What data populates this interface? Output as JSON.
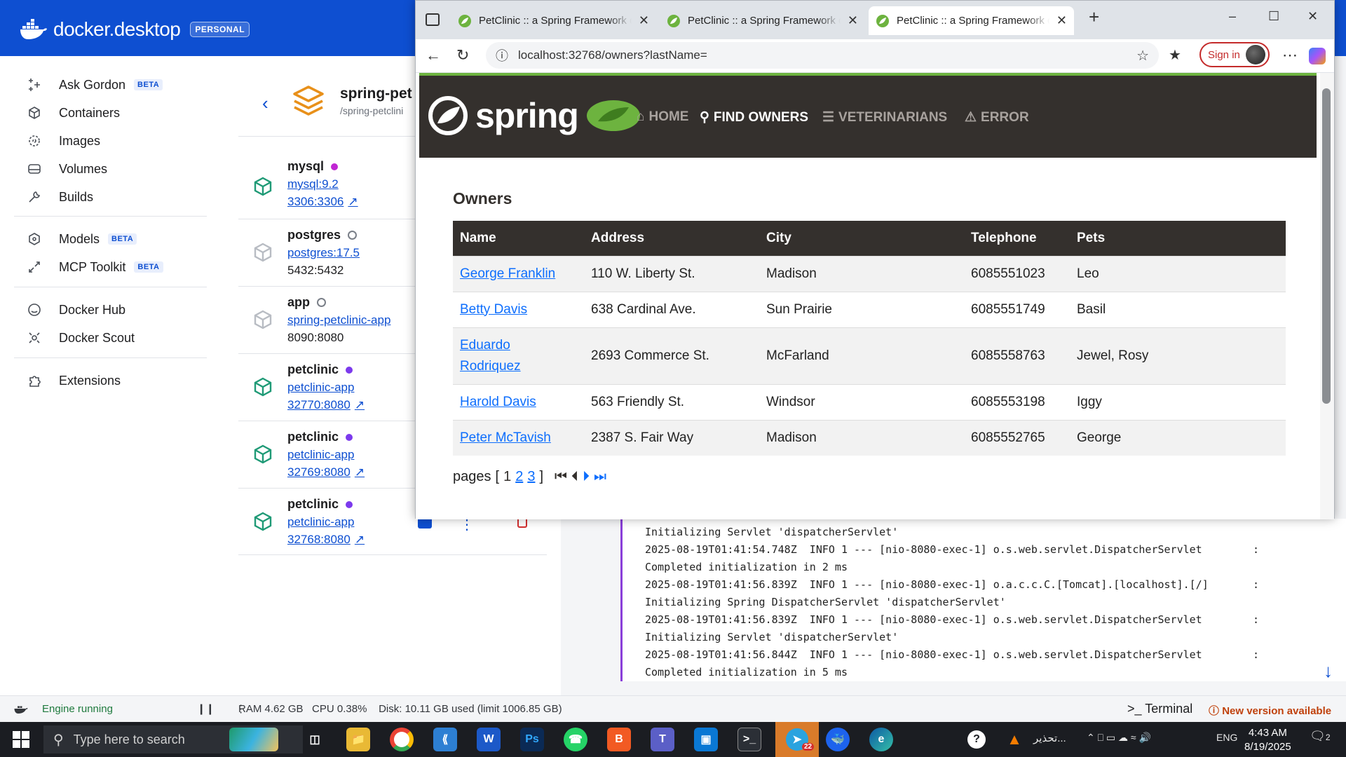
{
  "docker": {
    "brand": "docker.desktop",
    "plan_badge": "PERSONAL",
    "nav": {
      "ask_gordon": "Ask Gordon",
      "containers": "Containers",
      "images": "Images",
      "volumes": "Volumes",
      "builds": "Builds",
      "models": "Models",
      "mcp_toolkit": "MCP Toolkit",
      "docker_hub": "Docker Hub",
      "docker_scout": "Docker Scout",
      "extensions": "Extensions",
      "beta": "BETA"
    },
    "stack": {
      "title": "spring-pet",
      "subtitle": "/spring-petclini"
    },
    "containers": [
      {
        "name": "mysql",
        "image": "mysql:9.2",
        "ports": "3306:3306",
        "status_color": "#c026d3"
      },
      {
        "name": "postgres",
        "image": "postgres:17.5",
        "ports": "5432:5432",
        "status_color": ""
      },
      {
        "name": "app",
        "image": "spring-petclinic-app",
        "ports": "8090:8080",
        "status_color": ""
      },
      {
        "name": "petclinic",
        "image": "petclinic-app",
        "ports": "32770:8080",
        "status_color": "#7c3aed"
      },
      {
        "name": "petclinic",
        "image": "petclinic-app",
        "ports": "32769:8080",
        "status_color": "#7c3aed"
      },
      {
        "name": "petclinic",
        "image": "petclinic-app",
        "ports": "32768:8080",
        "status_color": "#7c3aed"
      }
    ],
    "logs": [
      "Initializing Servlet 'dispatcherServlet'",
      "2025-08-19T01:41:54.748Z  INFO 1 --- [nio-8080-exec-1] o.s.web.servlet.DispatcherServlet        :",
      "Completed initialization in 2 ms",
      "2025-08-19T01:41:56.839Z  INFO 1 --- [nio-8080-exec-1] o.a.c.c.C.[Tomcat].[localhost].[/]       :",
      "Initializing Spring DispatcherServlet 'dispatcherServlet'",
      "2025-08-19T01:41:56.839Z  INFO 1 --- [nio-8080-exec-1] o.s.web.servlet.DispatcherServlet        :",
      "Initializing Servlet 'dispatcherServlet'",
      "2025-08-19T01:41:56.844Z  INFO 1 --- [nio-8080-exec-1] o.s.web.servlet.DispatcherServlet        :",
      "Completed initialization in 5 ms"
    ],
    "footer": {
      "engine": "Engine running",
      "stats": "RAM 4.62 GB   CPU 0.38%    Disk: 10.11 GB used (limit 1006.85 GB)",
      "terminal": "Terminal",
      "new_version": "New version available"
    }
  },
  "browser": {
    "tabs": [
      {
        "title": "PetClinic :: a Spring Framework demonstration"
      },
      {
        "title": "PetClinic :: a Spring Framework demonstration"
      },
      {
        "title": "PetClinic :: a Spring Framework demonstration"
      }
    ],
    "url": "localhost:32768/owners?lastName=",
    "sign_in": "Sign in"
  },
  "petclinic": {
    "brand": "spring",
    "menu": {
      "home": "HOME",
      "find_owners": "FIND OWNERS",
      "veterinarians": "VETERINARIANS",
      "error": "ERROR"
    },
    "heading": "Owners",
    "columns": [
      "Name",
      "Address",
      "City",
      "Telephone",
      "Pets"
    ],
    "owners": [
      {
        "name": "George Franklin",
        "address": "110 W. Liberty St.",
        "city": "Madison",
        "telephone": "6085551023",
        "pets": "Leo"
      },
      {
        "name": "Betty Davis",
        "address": "638 Cardinal Ave.",
        "city": "Sun Prairie",
        "telephone": "6085551749",
        "pets": "Basil"
      },
      {
        "name": "Eduardo Rodriquez",
        "address": "2693 Commerce St.",
        "city": "McFarland",
        "telephone": "6085558763",
        "pets": "Jewel, Rosy"
      },
      {
        "name": "Harold Davis",
        "address": "563 Friendly St.",
        "city": "Windsor",
        "telephone": "6085553198",
        "pets": "Iggy"
      },
      {
        "name": "Peter McTavish",
        "address": "2387 S. Fair Way",
        "city": "Madison",
        "telephone": "6085552765",
        "pets": "George"
      }
    ],
    "pager": {
      "label": "pages",
      "open": "[",
      "close": "]",
      "current": "1",
      "page2": "2",
      "page3": "3"
    }
  },
  "taskbar": {
    "search_placeholder": "Type here to search",
    "tray_text": "تحذير...",
    "lang": "ENG",
    "time": "4:43 AM",
    "date": "8/19/2025",
    "notif_count": "2",
    "telegram_badge": "22"
  }
}
